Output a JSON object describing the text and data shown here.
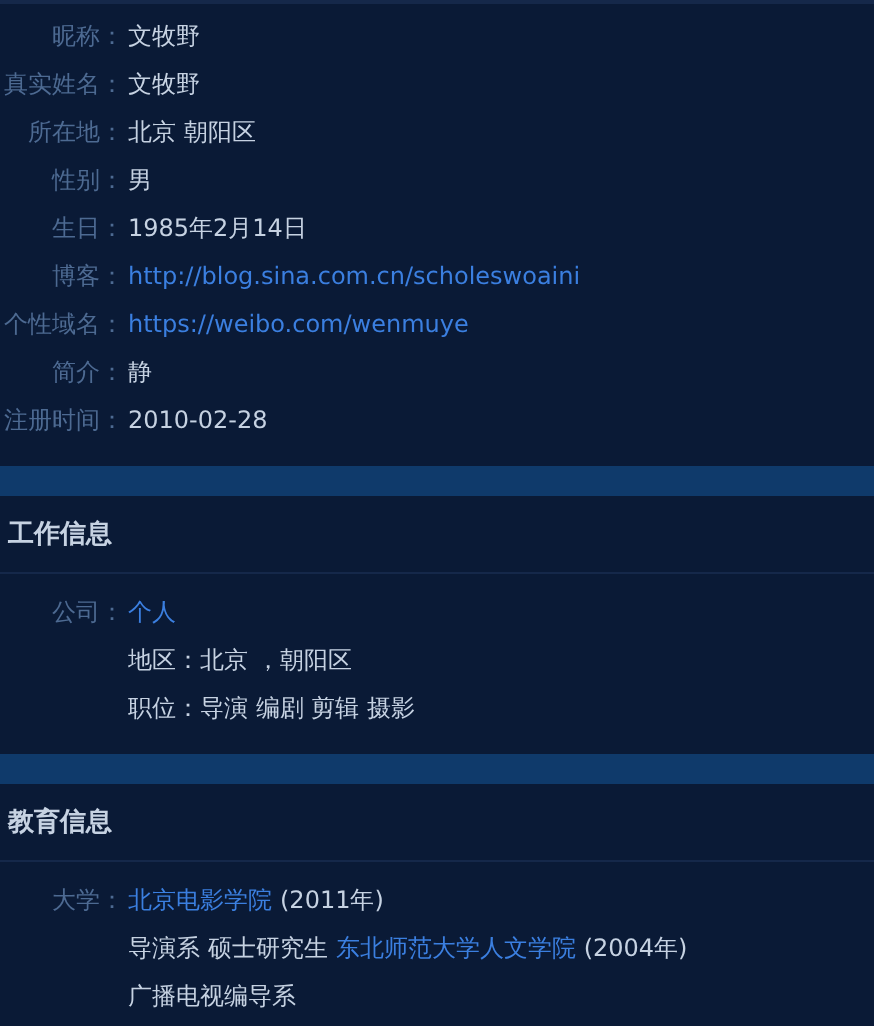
{
  "basic": [
    {
      "label": "昵称：",
      "value": "文牧野",
      "kind": "text"
    },
    {
      "label": "真实姓名：",
      "value": "文牧野",
      "kind": "text"
    },
    {
      "label": "所在地：",
      "value": "北京 朝阳区",
      "kind": "text"
    },
    {
      "label": "性别：",
      "value": "男",
      "kind": "text"
    },
    {
      "label": "生日：",
      "value": "1985年2月14日",
      "kind": "text"
    },
    {
      "label": "博客：",
      "value": "http://blog.sina.com.cn/scholeswoaini",
      "kind": "link"
    },
    {
      "label": "个性域名：",
      "value": "https://weibo.com/wenmuye",
      "kind": "link"
    },
    {
      "label": "简介：",
      "value": "静",
      "kind": "text"
    },
    {
      "label": "注册时间：",
      "value": "2010-02-28",
      "kind": "text"
    }
  ],
  "sections": [
    {
      "title": "工作信息",
      "label": "公司：",
      "lines": [
        [
          {
            "text": "个人",
            "kind": "link"
          }
        ],
        [
          {
            "text": "地区：北京 ，朝阳区",
            "kind": "text"
          }
        ],
        [
          {
            "text": "职位：导演 编剧 剪辑 摄影",
            "kind": "text"
          }
        ]
      ]
    },
    {
      "title": "教育信息",
      "label": "大学：",
      "lines": [
        [
          {
            "text": "北京电影学院",
            "kind": "link"
          },
          {
            "text": "(2011年)",
            "kind": "text"
          }
        ],
        [
          {
            "text": "导演系 硕士研究生",
            "kind": "text"
          },
          {
            "text": "东北师范大学人文学院",
            "kind": "link"
          },
          {
            "text": "(2004年)",
            "kind": "text"
          }
        ],
        [
          {
            "text": "广播电视编导系",
            "kind": "text"
          }
        ]
      ]
    }
  ]
}
